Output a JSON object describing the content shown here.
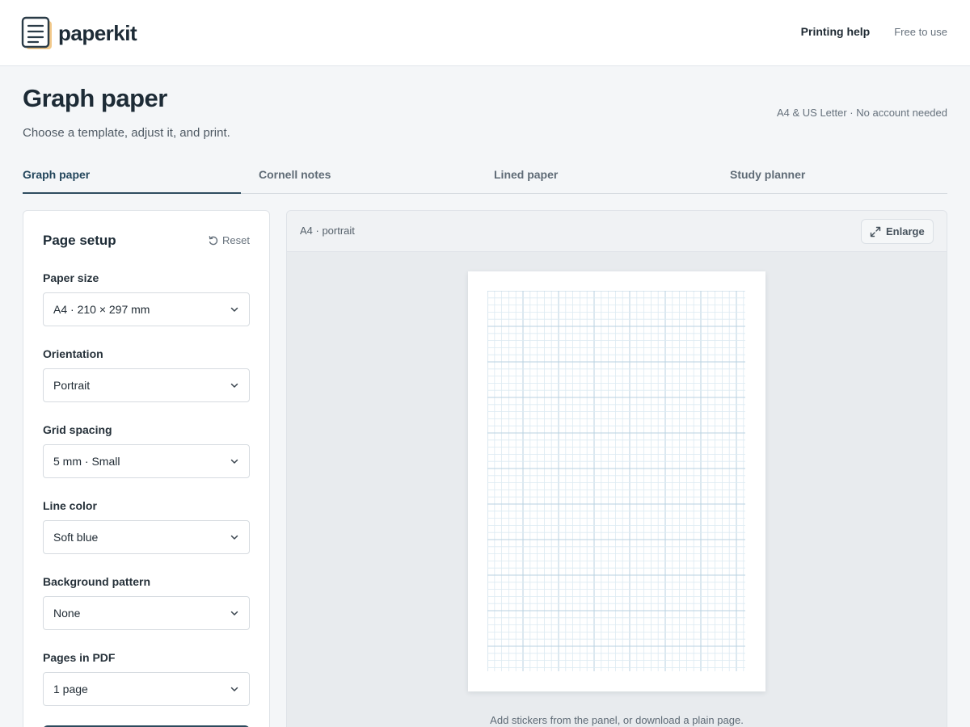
{
  "header": {
    "brand": "paperkit",
    "nav": [
      {
        "label": "Printing help"
      },
      {
        "label": "Free to use"
      }
    ]
  },
  "page": {
    "title": "Graph paper",
    "subtitle": "Choose a template, adjust it, and print.",
    "meta": "A4 & US Letter · No account needed"
  },
  "tabs": [
    {
      "label": "Graph paper",
      "active": true
    },
    {
      "label": "Cornell notes",
      "active": false
    },
    {
      "label": "Lined paper",
      "active": false
    },
    {
      "label": "Study planner",
      "active": false
    }
  ],
  "setup": {
    "title": "Page setup",
    "reset_label": "Reset",
    "fields": [
      {
        "label": "Paper size",
        "value": "A4 · 210 × 297 mm"
      },
      {
        "label": "Orientation",
        "value": "Portrait"
      },
      {
        "label": "Grid spacing",
        "value": "5 mm · Small"
      },
      {
        "label": "Line color",
        "value": "Soft blue"
      },
      {
        "label": "Background pattern",
        "value": "None"
      },
      {
        "label": "Pages in PDF",
        "value": "1 page"
      }
    ]
  },
  "preview": {
    "label": "A4 · portrait",
    "enlarge_label": "Enlarge",
    "caption": "Add stickers from the panel, or download a plain page."
  },
  "colors": {
    "accent": "#2c4a5d",
    "grid_minor": "#dceaf2",
    "grid_major": "#b9d2e1"
  },
  "icons": {
    "logo": "notepad-icon",
    "reset": "rotate-ccw-icon",
    "enlarge": "expand-arrows-icon",
    "select": "chevron-down-icon"
  }
}
